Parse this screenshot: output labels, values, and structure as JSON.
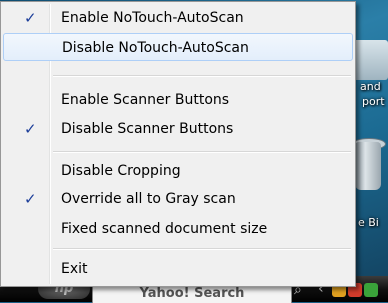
{
  "desktop": {
    "icon_top_label_line1": "and",
    "icon_top_label_line2": "port",
    "recycle_bin_label": "e Bi"
  },
  "taskbar": {
    "search_text": "Yahoo! Search"
  },
  "menu": {
    "items": [
      {
        "label": "Enable NoTouch-AutoScan",
        "checked": true
      },
      {
        "label": "Disable NoTouch-AutoScan",
        "checked": false,
        "highlighted": true
      },
      {
        "label": "Enable Scanner Buttons",
        "checked": false
      },
      {
        "label": "Disable Scanner Buttons",
        "checked": true
      },
      {
        "label": "Disable Cropping",
        "checked": false
      },
      {
        "label": "Override all to Gray scan",
        "checked": true
      },
      {
        "label": "Fixed scanned document size",
        "checked": false
      },
      {
        "label": "Exit",
        "checked": false
      }
    ],
    "check_glyph": "✓"
  },
  "colors": {
    "menu_background": "#f0f0f0",
    "highlight_border": "#aecff7",
    "check_color": "#1d3f9a"
  }
}
